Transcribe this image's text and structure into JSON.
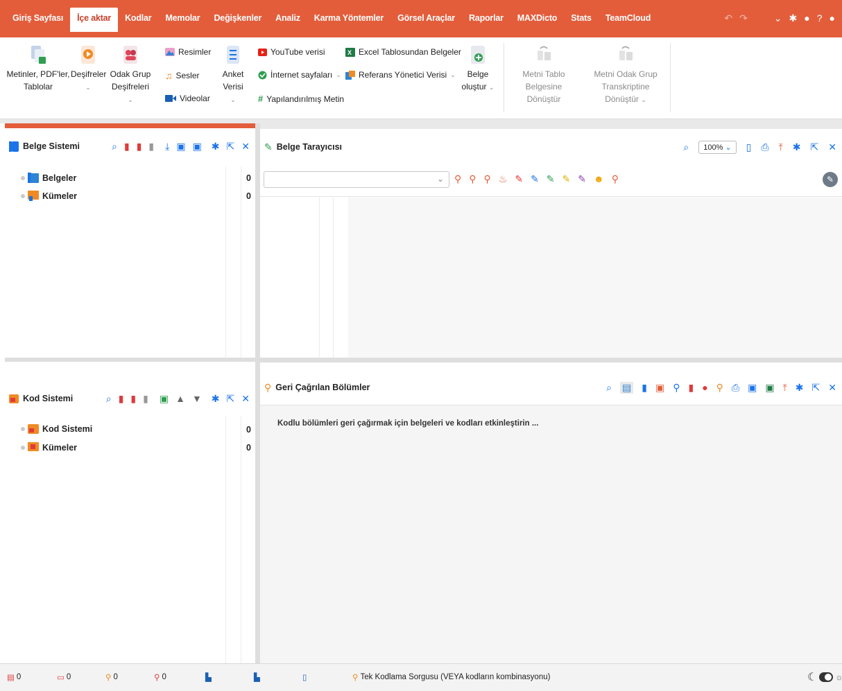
{
  "menubar": {
    "tabs": [
      "Giriş Sayfası",
      "İçe aktar",
      "Kodlar",
      "Memolar",
      "Değişkenler",
      "Analiz",
      "Karma Yöntemler",
      "Görsel Araçlar",
      "Raporlar",
      "MAXDicto",
      "Stats",
      "TeamCloud"
    ],
    "active_tab": "İçe aktar"
  },
  "ribbon": {
    "texts_l1": "Metinler, PDF'ler,",
    "texts_l2": "Tablolar",
    "transcripts": "Deşifreler",
    "focus_l1": "Odak Grup",
    "focus_l2": "Deşifreleri",
    "images": "Resimler",
    "audio": "Sesler",
    "videos": "Videolar",
    "survey_l1": "Anket",
    "survey_l2": "Verisi",
    "youtube": "YouTube verisi",
    "web": "İnternet sayfaları",
    "structured": "Yapılandırılmış Metin",
    "excel": "Excel Tablosundan Belgeler",
    "refmgr": "Referans Yönetici Verisi",
    "create_l1": "Belge",
    "create_l2": "oluştur",
    "convert_table_l1": "Metni Tablo Belgesine",
    "convert_table_l2": "Dönüştür",
    "convert_focus_l1": "Metni Odak Grup",
    "convert_focus_l2": "Transkriptine Dönüştür"
  },
  "doc_system": {
    "title": "Belge Sistemi",
    "items": [
      {
        "label": "Belgeler",
        "count": "0"
      },
      {
        "label": "Kümeler",
        "count": "0"
      }
    ]
  },
  "doc_browser": {
    "title": "Belge Tarayıcısı",
    "zoom": "100%"
  },
  "code_system": {
    "title": "Kod Sistemi",
    "items": [
      {
        "label": "Kod Sistemi",
        "count": "0"
      },
      {
        "label": "Kümeler",
        "count": "0"
      }
    ]
  },
  "retrieved": {
    "title": "Geri Çağrılan Bölümler",
    "message": "Kodlu bölümleri geri çağırmak için belgeleri ve kodları etkinleştirin ..."
  },
  "status": {
    "docs": "0",
    "codes": "0",
    "memos": "0",
    "segments": "0",
    "query": "Tek Kodlama Sorgusu (VEYA kodların kombinasyonu)"
  },
  "colors": {
    "accent": "#e35d3b",
    "blue": "#1a73e8",
    "orange": "#f08a24",
    "red": "#e03a3a"
  }
}
